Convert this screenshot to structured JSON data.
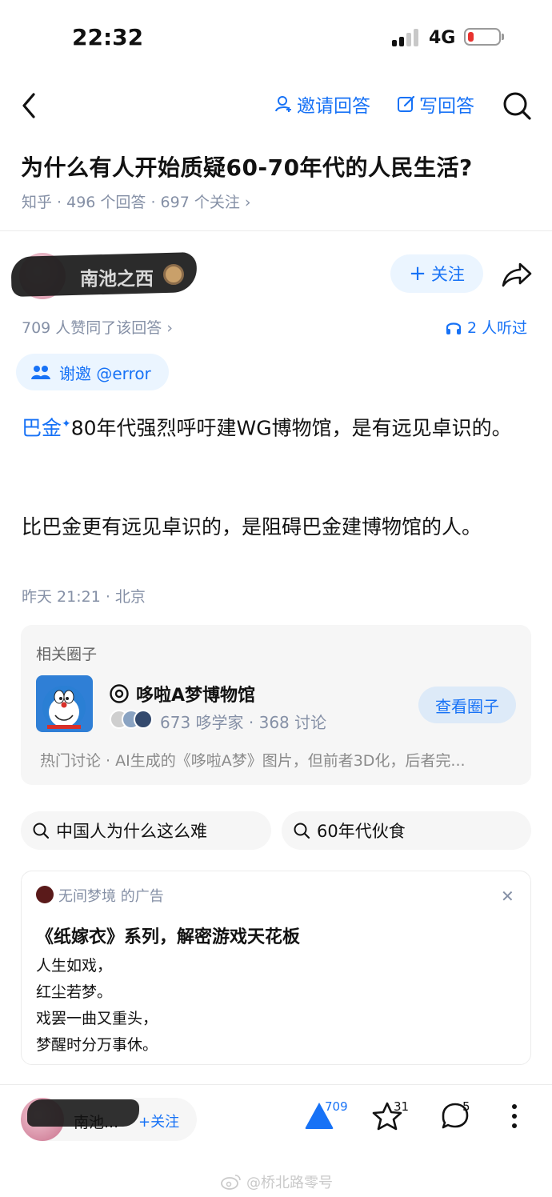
{
  "status_bar": {
    "time": "22:32",
    "network": "4G"
  },
  "nav": {
    "invite_label": "邀请回答",
    "write_label": "写回答"
  },
  "question": {
    "title": "为什么有人开始质疑60-70年代的人民生活?",
    "meta": "知乎 · 496 个回答 · 697 个关注 ›"
  },
  "author": {
    "name": "南池之西",
    "follow_label": "关注"
  },
  "answer": {
    "likes_line": "709 人赞同了该回答 ›",
    "listen": "2 人听过",
    "invite_chip": "谢邀 @error",
    "link_text": "巴金",
    "para1_rest": "80年代强烈呼吁建WG博物馆，是有远见卓识的。",
    "para2": "比巴金更有远见卓识的，是阻碍巴金建博物馆的人。",
    "time_loc": "昨天 21:21 · 北京"
  },
  "circle": {
    "header": "相关圈子",
    "name": "哆啦A梦博物馆",
    "stats": "673 哆学家 · 368 讨论",
    "button": "查看圈子",
    "hot": "热门讨论 · AI生成的《哆啦A梦》图片，但前者3D化，后者完..."
  },
  "search_chips": [
    "中国人为什么这么难",
    "60年代伙食"
  ],
  "ad": {
    "source": "无间梦境 的广告",
    "close": "✕",
    "title": "《纸嫁衣》系列，解密游戏天花板",
    "lines": [
      "人生如戏，",
      "红尘若梦。",
      "戏罢一曲又重头，",
      "梦醒时分万事休。"
    ]
  },
  "bottom_bar": {
    "author_short": "南池...",
    "follow": "+关注",
    "upvotes": "709",
    "favorites": "31",
    "comments": "5"
  },
  "watermark": "@桥北路零号",
  "colors": {
    "accent": "#1772f6",
    "accent_bg": "#ebf5ff",
    "meta": "#8590a6"
  }
}
